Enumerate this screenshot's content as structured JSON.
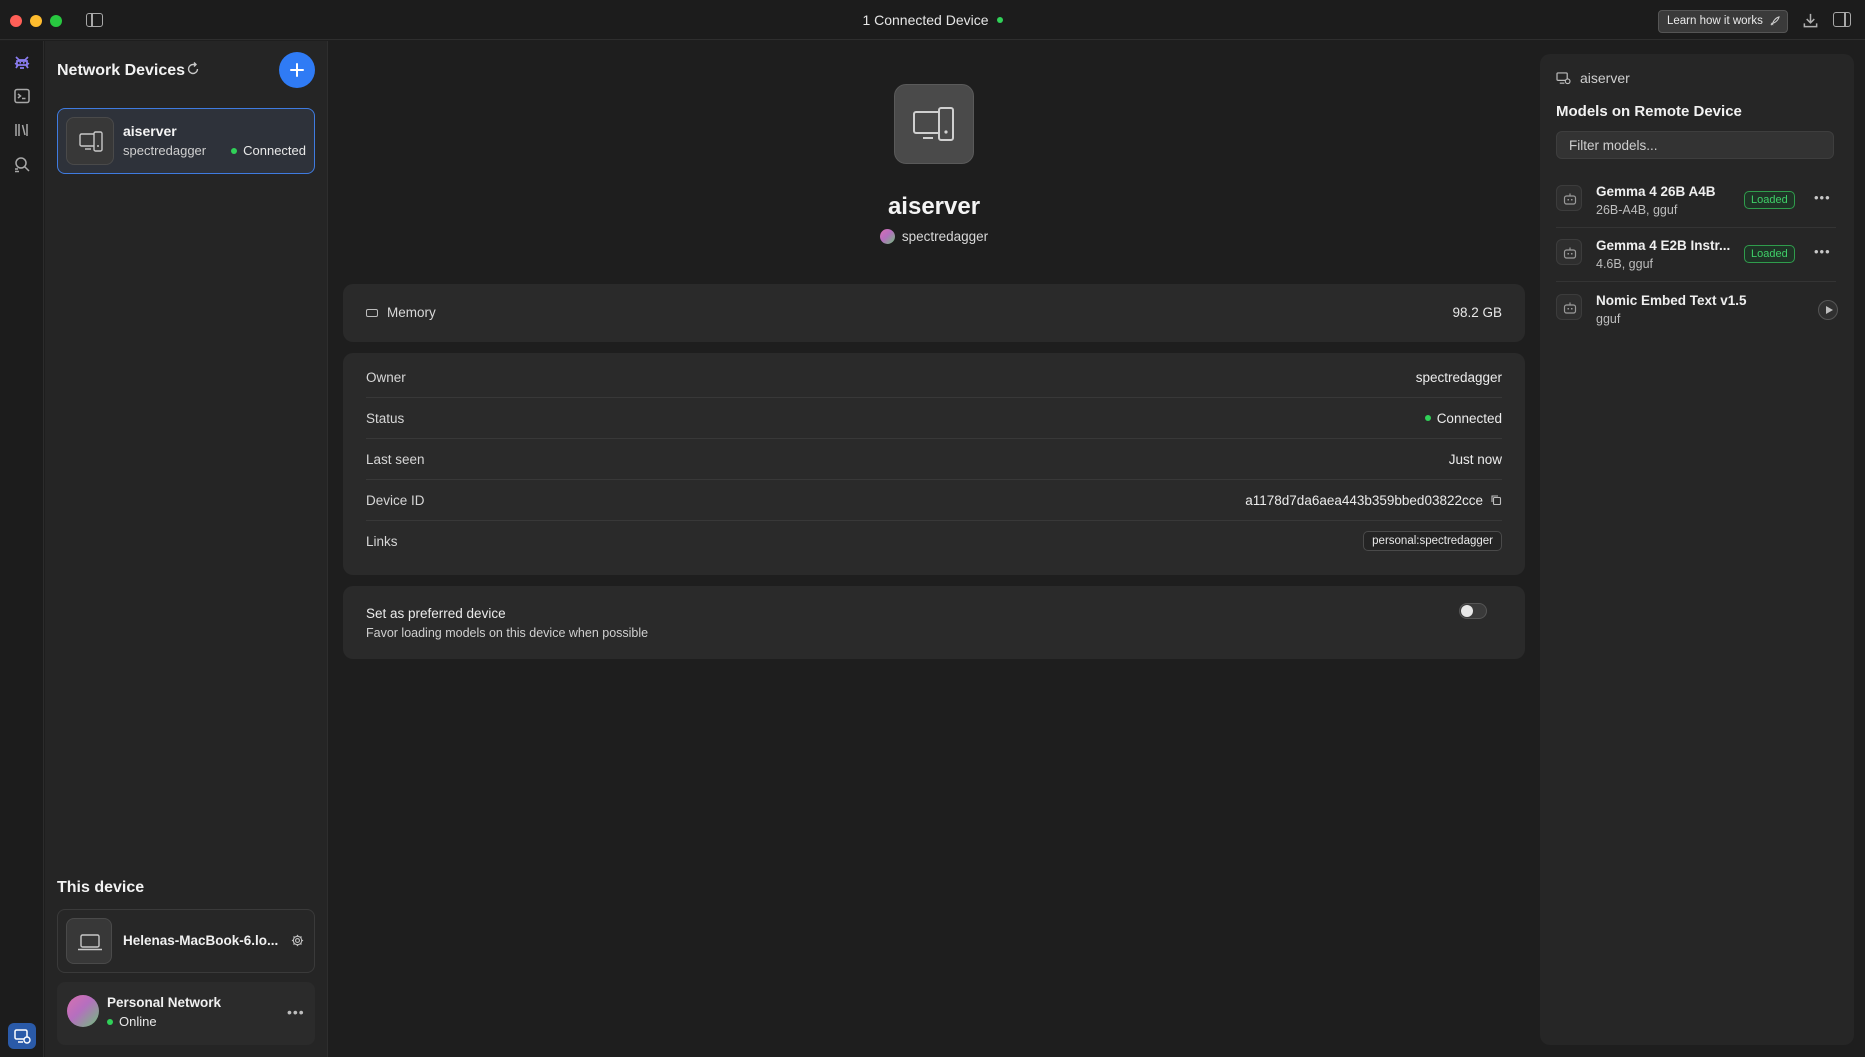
{
  "window": {
    "title": "1 Connected Device",
    "learn_button": "Learn how it works"
  },
  "rail": {
    "icons": [
      "app-logo-icon",
      "chat-icon",
      "developer-icon",
      "discover-icon",
      "devices-icon",
      "settings-icon"
    ]
  },
  "devices_panel": {
    "title": "Network Devices",
    "devices": [
      {
        "name": "aiserver",
        "user": "spectredagger",
        "status": "Connected"
      }
    ],
    "this_device_title": "This device",
    "local_device": {
      "name": "Helenas-MacBook-6.lo..."
    },
    "network": {
      "name": "Personal Network",
      "status": "Online"
    }
  },
  "main": {
    "device_name": "aiserver",
    "owner_handle": "spectredagger",
    "memory": {
      "label": "Memory",
      "value": "98.2 GB"
    },
    "details": [
      {
        "label": "Owner",
        "value": "spectredagger"
      },
      {
        "label": "Status",
        "value": "Connected"
      },
      {
        "label": "Last seen",
        "value": "Just now"
      },
      {
        "label": "Device ID",
        "value": "a1178d7da6aea443b359bbed03822cce"
      },
      {
        "label": "Links",
        "value": "personal:spectredagger"
      }
    ],
    "preferred": {
      "title": "Set as preferred device",
      "subtitle": "Favor loading models on this device when possible",
      "enabled": false
    }
  },
  "remote_panel": {
    "device_name": "aiserver",
    "title": "Models on Remote Device",
    "filter_placeholder": "Filter models...",
    "models": [
      {
        "name": "Gemma 4 26B A4B",
        "meta": "26B-A4B, gguf",
        "status": "Loaded"
      },
      {
        "name": "Gemma 4 E2B Instr...",
        "meta": "4.6B, gguf",
        "status": "Loaded"
      },
      {
        "name": "Nomic Embed Text v1.5",
        "meta": "gguf",
        "status": ""
      }
    ]
  },
  "colors": {
    "accent": "#2f7bf5",
    "online": "#30d158",
    "loaded": "#3fcf68"
  }
}
